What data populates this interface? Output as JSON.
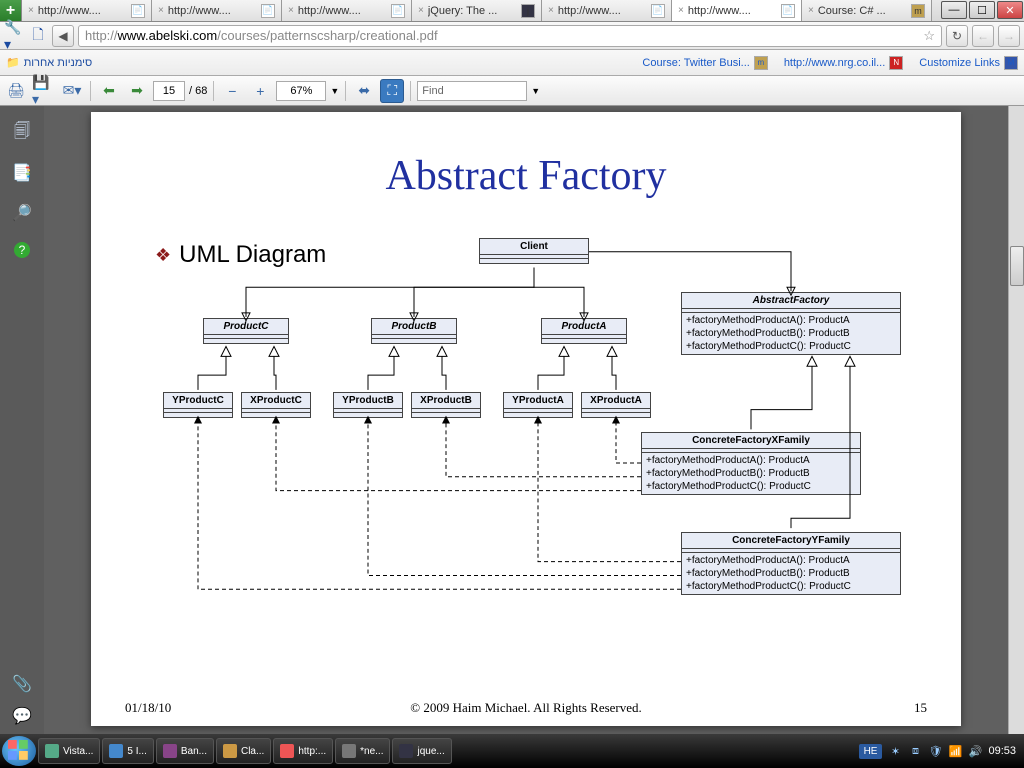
{
  "browser": {
    "tabs": [
      {
        "label": "http://www....",
        "active": false
      },
      {
        "label": "http://www....",
        "active": false
      },
      {
        "label": "http://www....",
        "active": false
      },
      {
        "label": "jQuery: The ...",
        "active": false
      },
      {
        "label": "http://www....",
        "active": false
      },
      {
        "label": "http://www....",
        "active": true
      },
      {
        "label": "Course: C# ...",
        "active": false
      }
    ],
    "url_prefix": "http://",
    "url_host": "www.abelski.com",
    "url_path": "/courses/patternscsharp/creational.pdf",
    "bookmarks_folder": "סימניות אחרות",
    "bookmark_links": [
      {
        "label": "Course: Twitter Busi..."
      },
      {
        "label": "http://www.nrg.co.il..."
      },
      {
        "label": "Customize Links"
      }
    ]
  },
  "pdf": {
    "page_current": "15",
    "page_total": "68",
    "zoom": "67%",
    "find_placeholder": "Find"
  },
  "slide": {
    "title": "Abstract Factory",
    "bullet": "UML Diagram",
    "date": "01/18/10",
    "copyright": "© 2009 Haim Michael. All Rights Reserved.",
    "page_number": "15"
  },
  "uml": {
    "client": "Client",
    "productA": "ProductA",
    "productB": "ProductB",
    "productC": "ProductC",
    "xProductA": "XProductA",
    "yProductA": "YProductA",
    "xProductB": "XProductB",
    "yProductB": "YProductB",
    "xProductC": "XProductC",
    "yProductC": "YProductC",
    "absFactory": "AbstractFactory",
    "absFactory_m1": "+factoryMethodProductA(): ProductA",
    "absFactory_m2": "+factoryMethodProductB(): ProductB",
    "absFactory_m3": "+factoryMethodProductC(): ProductC",
    "concX": "ConcreteFactoryXFamily",
    "concX_m1": "+factoryMethodProductA(): ProductA",
    "concX_m2": "+factoryMethodProductB(): ProductB",
    "concX_m3": "+factoryMethodProductC(): ProductC",
    "concY": "ConcreteFactoryYFamily",
    "concY_m1": "+factoryMethodProductA(): ProductA",
    "concY_m2": "+factoryMethodProductB(): ProductB",
    "concY_m3": "+factoryMethodProductC(): ProductC"
  },
  "taskbar": {
    "buttons": [
      "Vista...",
      "5 I...",
      "Ban...",
      "Cla...",
      "http:...",
      "*ne...",
      "jque..."
    ],
    "lang": "HE",
    "clock": "09:53"
  }
}
